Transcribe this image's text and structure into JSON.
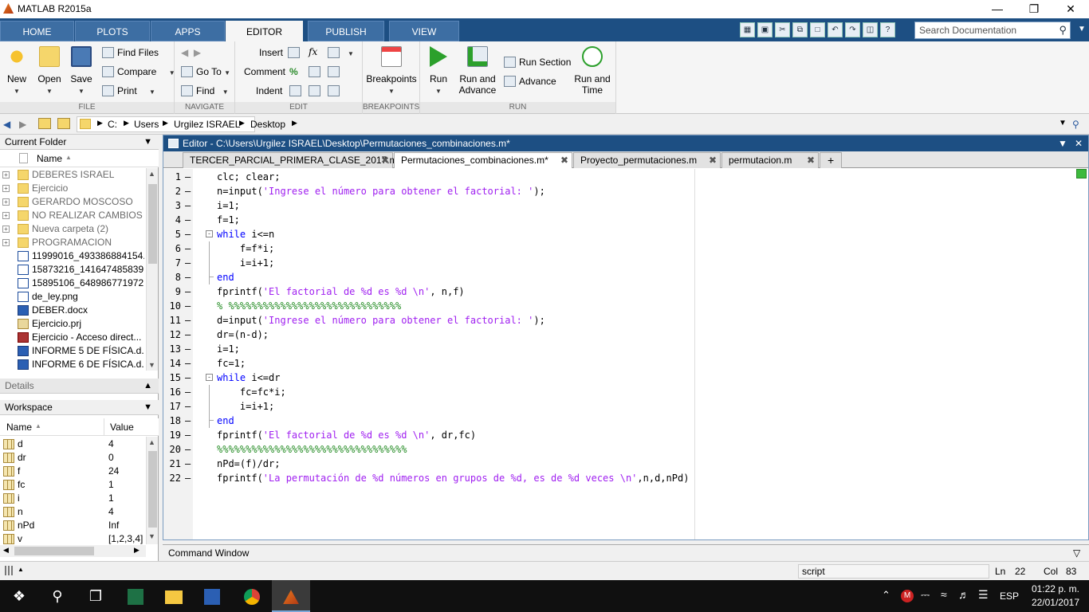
{
  "window": {
    "title": "MATLAB R2015a"
  },
  "ribbon_tabs": [
    "HOME",
    "PLOTS",
    "APPS",
    "EDITOR",
    "PUBLISH",
    "VIEW"
  ],
  "search": {
    "placeholder": "Search Documentation"
  },
  "file": {
    "new": "New",
    "open": "Open",
    "save": "Save",
    "find_files": "Find Files",
    "compare": "Compare",
    "print": "Print",
    "label": "FILE"
  },
  "navigate": {
    "go_to": "Go To",
    "find": "Find",
    "label": "NAVIGATE"
  },
  "edit": {
    "insert": "Insert",
    "comment": "Comment",
    "indent": "Indent",
    "fx": "fx",
    "label": "EDIT"
  },
  "breakpoints": {
    "breakpoints": "Breakpoints",
    "label": "BREAKPOINTS"
  },
  "run": {
    "run": "Run",
    "run_and_advance_1": "Run and",
    "run_and_advance_2": "Advance",
    "run_section": "Run Section",
    "advance": "Advance",
    "run_and_time_1": "Run and",
    "run_and_time_2": "Time",
    "label": "RUN"
  },
  "address": {
    "parts": [
      "C:",
      "Users",
      "Urgilez ISRAEL",
      "Desktop"
    ]
  },
  "current_folder": {
    "title": "Current Folder",
    "col_name": "Name",
    "items": [
      {
        "name": "DEBERES ISRAEL",
        "type": "folder"
      },
      {
        "name": "Ejercicio",
        "type": "folder"
      },
      {
        "name": "GERARDO MOSCOSO",
        "type": "folder"
      },
      {
        "name": "NO REALIZAR CAMBIOS",
        "type": "folder"
      },
      {
        "name": "Nueva carpeta (2)",
        "type": "folder"
      },
      {
        "name": "PROGRAMACION",
        "type": "folder"
      },
      {
        "name": "11999016_493386884154...",
        "type": "img"
      },
      {
        "name": "15873216_141647485839...",
        "type": "img"
      },
      {
        "name": "15895106_648986771972...",
        "type": "img"
      },
      {
        "name": "de_ley.png",
        "type": "img"
      },
      {
        "name": "DEBER.docx",
        "type": "docx"
      },
      {
        "name": "Ejercicio.prj",
        "type": "prj"
      },
      {
        "name": "Ejercicio - Acceso direct...",
        "type": "lnk"
      },
      {
        "name": "INFORME 5 DE FÍSICA.d...",
        "type": "docx"
      },
      {
        "name": "INFORME 6 DE FÍSICA.d...",
        "type": "docx"
      }
    ]
  },
  "details": {
    "title": "Details"
  },
  "workspace": {
    "title": "Workspace",
    "col_name": "Name",
    "col_value": "Value",
    "vars": [
      {
        "name": "d",
        "value": "4"
      },
      {
        "name": "dr",
        "value": "0"
      },
      {
        "name": "f",
        "value": "24"
      },
      {
        "name": "fc",
        "value": "1"
      },
      {
        "name": "i",
        "value": "1"
      },
      {
        "name": "n",
        "value": "4"
      },
      {
        "name": "nPd",
        "value": "Inf"
      },
      {
        "name": "v",
        "value": "[1,2,3,4]"
      }
    ]
  },
  "editor": {
    "title": "Editor - C:\\Users\\Urgilez ISRAEL\\Desktop\\Permutaciones_combinaciones.m*",
    "tabs": [
      "TERCER_PARCIAL_PRIMERA_CLASE_2017.m",
      "Permutaciones_combinaciones.m*",
      "Proyecto_permutaciones.m",
      "permutacion.m"
    ],
    "add_tab": "+"
  },
  "code_lines": [
    [
      {
        "t": "clc; clear;",
        "c": ""
      }
    ],
    [
      {
        "t": "n=input(",
        "c": ""
      },
      {
        "t": "'Ingrese el número para obtener el factorial: '",
        "c": "st"
      },
      {
        "t": ");",
        "c": ""
      }
    ],
    [
      {
        "t": "i=1;",
        "c": ""
      }
    ],
    [
      {
        "t": "f=1;",
        "c": ""
      }
    ],
    [
      {
        "t": "while",
        "c": "kw"
      },
      {
        "t": " i<=n",
        "c": ""
      }
    ],
    [
      {
        "t": "    f=f*i;",
        "c": ""
      }
    ],
    [
      {
        "t": "    i=i+1;",
        "c": ""
      }
    ],
    [
      {
        "t": "end",
        "c": "kw"
      }
    ],
    [
      {
        "t": "fprintf(",
        "c": ""
      },
      {
        "t": "'El factorial de %d es %d \\n'",
        "c": "st"
      },
      {
        "t": ", n,f)",
        "c": ""
      }
    ],
    [
      {
        "t": "% %%%%%%%%%%%%%%%%%%%%%%%%%%%%%%",
        "c": "cm"
      }
    ],
    [
      {
        "t": "d=input(",
        "c": ""
      },
      {
        "t": "'Ingrese el número para obtener el factorial: '",
        "c": "st"
      },
      {
        "t": ");",
        "c": ""
      }
    ],
    [
      {
        "t": "dr=(n-d);",
        "c": ""
      }
    ],
    [
      {
        "t": "i=1;",
        "c": ""
      }
    ],
    [
      {
        "t": "fc=1;",
        "c": ""
      }
    ],
    [
      {
        "t": "while",
        "c": "kw"
      },
      {
        "t": " i<=dr",
        "c": ""
      }
    ],
    [
      {
        "t": "    fc=fc*i;",
        "c": ""
      }
    ],
    [
      {
        "t": "    i=i+1;",
        "c": ""
      }
    ],
    [
      {
        "t": "end",
        "c": "kw"
      }
    ],
    [
      {
        "t": "fprintf(",
        "c": ""
      },
      {
        "t": "'El factorial de %d es %d \\n'",
        "c": "st"
      },
      {
        "t": ", dr,fc)",
        "c": ""
      }
    ],
    [
      {
        "t": "%%%%%%%%%%%%%%%%%%%%%%%%%%%%%%%%%",
        "c": "cm"
      }
    ],
    [
      {
        "t": "nPd=(f)/dr;",
        "c": ""
      }
    ],
    [
      {
        "t": "fprintf(",
        "c": ""
      },
      {
        "t": "'La permutación de %d números en grupos de %d, es de %d veces \\n'",
        "c": "st"
      },
      {
        "t": ",n,d,nPd)",
        "c": ""
      }
    ]
  ],
  "command_window": {
    "title": "Command Window"
  },
  "statusbar": {
    "mode": "script",
    "ln_label": "Ln",
    "ln": "22",
    "col_label": "Col",
    "col": "83"
  },
  "taskbar": {
    "lang": "ESP",
    "time": "01:22 p. m.",
    "date": "22/01/2017"
  }
}
